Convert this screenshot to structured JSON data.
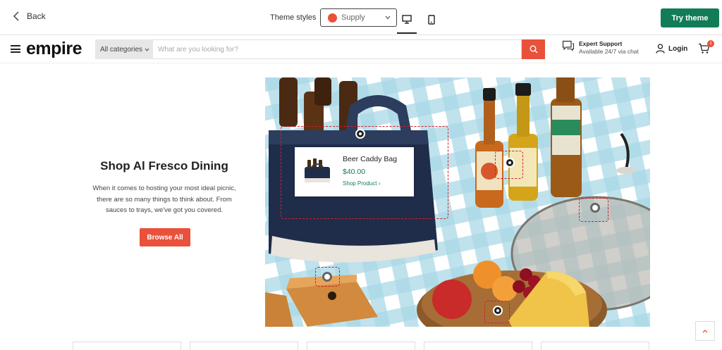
{
  "preview_bar": {
    "back_label": "Back",
    "theme_styles_label": "Theme styles",
    "theme_style_selected": "Supply",
    "theme_dot_color": "#e9513a",
    "try_theme_label": "Try theme",
    "try_theme_color": "#127c57",
    "device_selected": "desktop"
  },
  "store_header": {
    "logo": "empire",
    "category_select": "All categories",
    "search_placeholder": "What are you looking for?",
    "support_title": "Expert Support",
    "support_subtitle": "Available 24/7 via chat",
    "login_label": "Login",
    "cart_count": "1",
    "accent_color": "#e9513a"
  },
  "hero": {
    "title": "Shop Al Fresco Dining",
    "description": "When it comes to hosting your most ideal picnic, there are so many things to think about. From sauces to trays, we've got you covered.",
    "browse_label": "Browse All",
    "product_card": {
      "name": "Beer Caddy Bag",
      "price": "$40.00",
      "link_label": "Shop Product ›"
    }
  }
}
